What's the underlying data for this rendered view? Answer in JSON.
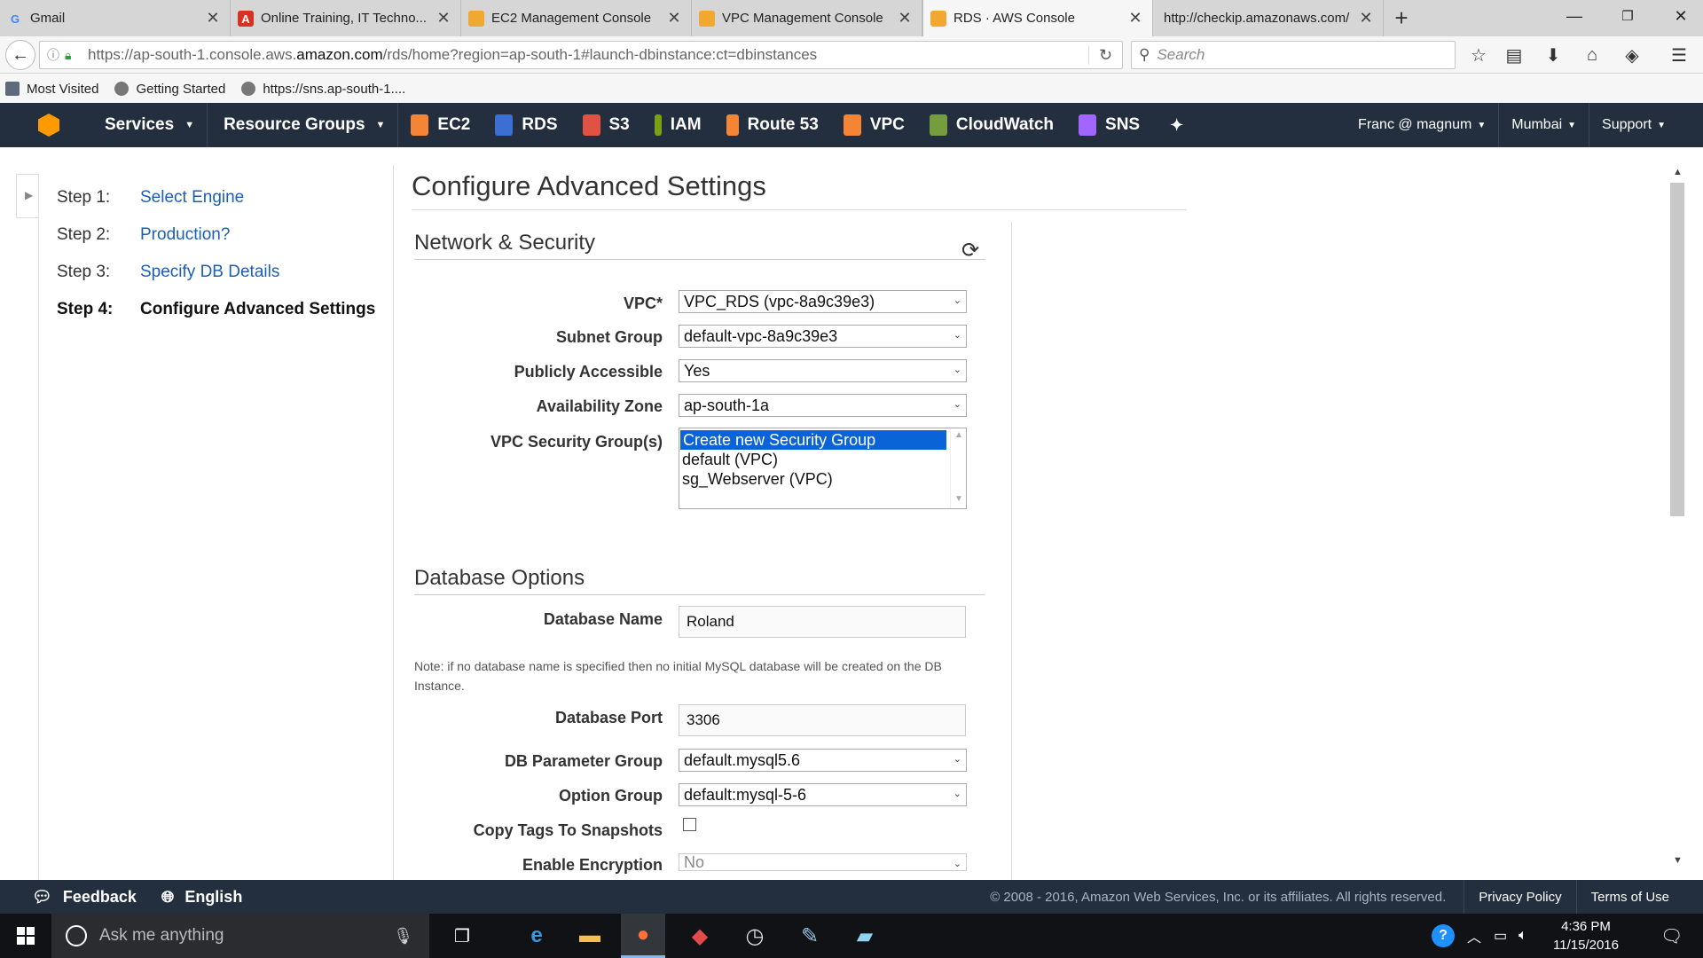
{
  "browser": {
    "tabs": [
      {
        "title": "Gmail",
        "icon": "gmail-icon",
        "color": "#4285f4"
      },
      {
        "title": "Online Training, IT Techno...",
        "icon": "training-site-icon",
        "color": "#d93025"
      },
      {
        "title": "EC2 Management Console",
        "icon": "aws-icon",
        "color": "#f0a830"
      },
      {
        "title": "VPC Management Console",
        "icon": "aws-icon",
        "color": "#f0a830"
      },
      {
        "title": "RDS · AWS Console",
        "icon": "aws-icon",
        "color": "#f0a830",
        "active": true
      },
      {
        "title": "http://checkip.amazonaws.com/",
        "icon": "page-icon",
        "color": "#999999"
      }
    ],
    "url_prefix": "https://ap-south-1.console.aws.",
    "url_domain": "amazon.com",
    "url_suffix": "/rds/home?region=ap-south-1#launch-dbinstance:ct=dbinstances",
    "search_placeholder": "Search",
    "bookmarks": [
      "Most Visited",
      "Getting Started",
      "https://sns.ap-south-1...."
    ]
  },
  "aws_nav": {
    "menus": [
      {
        "label": "Services"
      },
      {
        "label": "Resource Groups"
      }
    ],
    "services": [
      {
        "label": "EC2",
        "color": "#f58536"
      },
      {
        "label": "RDS",
        "color": "#3b6fd4"
      },
      {
        "label": "S3",
        "color": "#e05243"
      },
      {
        "label": "IAM",
        "color": "#7aa116"
      },
      {
        "label": "Route 53",
        "color": "#f58536"
      },
      {
        "label": "VPC",
        "color": "#f58536"
      },
      {
        "label": "CloudWatch",
        "color": "#759c3e"
      },
      {
        "label": "SNS",
        "color": "#a166ff"
      }
    ],
    "user": "Franc @ magnum",
    "region": "Mumbai",
    "support": "Support"
  },
  "wizard": {
    "steps": [
      {
        "num": "Step 1:",
        "label": "Select Engine"
      },
      {
        "num": "Step 2:",
        "label": "Production?"
      },
      {
        "num": "Step 3:",
        "label": "Specify DB Details"
      },
      {
        "num": "Step 4:",
        "label": "Configure Advanced Settings",
        "current": true
      }
    ],
    "page_title": "Configure Advanced Settings"
  },
  "network": {
    "section_title": "Network & Security",
    "vpc_label": "VPC*",
    "vpc_value": "VPC_RDS (vpc-8a9c39e3)",
    "subnet_label": "Subnet Group",
    "subnet_value": "default-vpc-8a9c39e3",
    "public_label": "Publicly Accessible",
    "public_value": "Yes",
    "az_label": "Availability Zone",
    "az_value": "ap-south-1a",
    "sg_label": "VPC Security Group(s)",
    "sg_options": [
      "Create new Security Group",
      "default (VPC)",
      "sg_Webserver (VPC)"
    ]
  },
  "database": {
    "section_title": "Database Options",
    "name_label": "Database Name",
    "name_value": "Roland",
    "note": "Note: if no database name is specified then no initial MySQL database will be created on the DB Instance.",
    "port_label": "Database Port",
    "port_value": "3306",
    "param_label": "DB Parameter Group",
    "param_value": "default.mysql5.6",
    "option_label": "Option Group",
    "option_value": "default:mysql-5-6",
    "copy_tags_label": "Copy Tags To Snapshots",
    "encryption_label": "Enable Encryption",
    "encryption_value": "No"
  },
  "footer": {
    "feedback": "Feedback",
    "language": "English",
    "copyright": "© 2008 - 2016, Amazon Web Services, Inc. or its affiliates. All rights reserved.",
    "privacy": "Privacy Policy",
    "terms": "Terms of Use"
  },
  "taskbar": {
    "search_placeholder": "Ask me anything",
    "time": "4:36 PM",
    "date": "11/15/2016"
  }
}
